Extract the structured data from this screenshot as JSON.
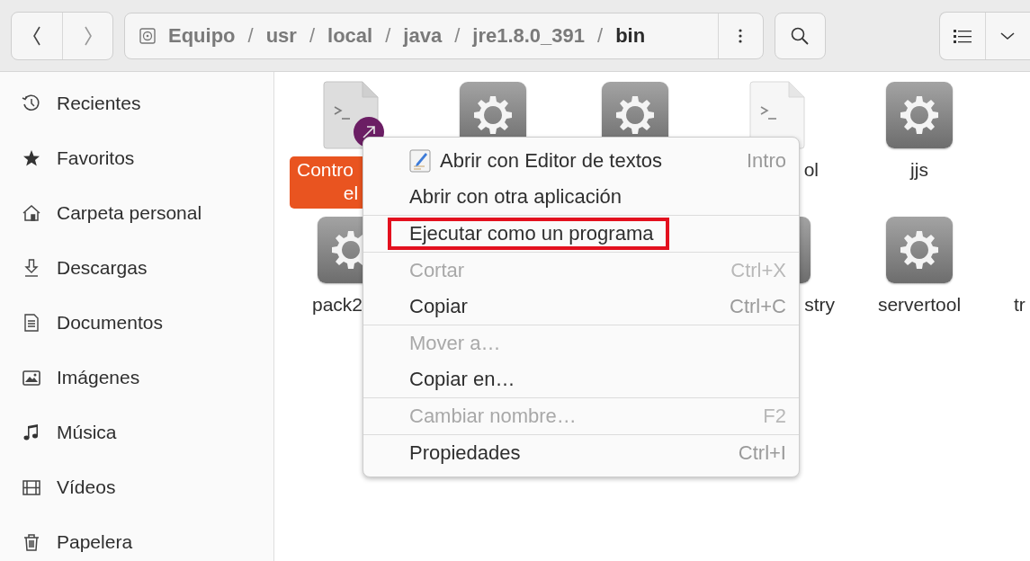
{
  "path_bar": {
    "separator": "/",
    "segments": [
      {
        "label": "Equipo",
        "current": false
      },
      {
        "label": "usr",
        "current": false
      },
      {
        "label": "local",
        "current": false
      },
      {
        "label": "java",
        "current": false
      },
      {
        "label": "jre1.8.0_391",
        "current": false
      },
      {
        "label": "bin",
        "current": true
      }
    ]
  },
  "sidebar": {
    "items": [
      {
        "label": "Recientes"
      },
      {
        "label": "Favoritos"
      },
      {
        "label": "Carpeta personal"
      },
      {
        "label": "Descargas"
      },
      {
        "label": "Documentos"
      },
      {
        "label": "Imágenes"
      },
      {
        "label": "Música"
      },
      {
        "label": "Vídeos"
      },
      {
        "label": "Papelera"
      }
    ]
  },
  "files": {
    "rows": [
      [
        {
          "kind": "script",
          "label": [
            "Contro",
            "el"
          ],
          "selected": true,
          "link": true
        },
        {
          "kind": "gear",
          "selected": false
        },
        {
          "kind": "gear",
          "selected": false
        },
        {
          "kind": "script",
          "label": [
            "ol"
          ],
          "selected": false
        },
        {
          "kind": "gear",
          "label": [
            "jjs"
          ],
          "selected": false
        }
      ],
      [
        {
          "kind": "gear",
          "label": [
            "pack2"
          ],
          "selected": false
        },
        {
          "kind": "covered"
        },
        {
          "kind": "covered"
        },
        {
          "kind": "gear",
          "label": [
            "stry"
          ],
          "selected": false
        },
        {
          "kind": "gear",
          "label": [
            "servertool"
          ],
          "selected": false
        },
        {
          "kind": "covered",
          "label": [
            "tr"
          ]
        }
      ]
    ]
  },
  "context_menu": {
    "items": [
      {
        "label": "Abrir con Editor de textos",
        "shortcut": "Intro",
        "disabled": false,
        "icon": true,
        "highlighted": false,
        "separator_before": false
      },
      {
        "label": "Abrir con otra aplicación",
        "disabled": false,
        "icon": false,
        "highlighted": false,
        "separator_before": false
      },
      {
        "label": "Ejecutar como un programa",
        "disabled": false,
        "icon": false,
        "highlighted": true,
        "separator_before": true
      },
      {
        "label": "Cortar",
        "shortcut": "Ctrl+X",
        "disabled": true,
        "icon": false,
        "highlighted": false,
        "separator_before": true
      },
      {
        "label": "Copiar",
        "shortcut": "Ctrl+C",
        "disabled": false,
        "icon": false,
        "highlighted": false,
        "separator_before": false
      },
      {
        "label": "Mover a…",
        "disabled": true,
        "icon": false,
        "highlighted": false,
        "separator_before": true
      },
      {
        "label": "Copiar en…",
        "disabled": false,
        "icon": false,
        "highlighted": false,
        "separator_before": false
      },
      {
        "label": "Cambiar nombre…",
        "shortcut": "F2",
        "disabled": true,
        "icon": false,
        "highlighted": false,
        "separator_before": true
      },
      {
        "label": "Propiedades",
        "shortcut": "Ctrl+I",
        "disabled": false,
        "icon": false,
        "highlighted": false,
        "separator_before": true
      }
    ]
  }
}
